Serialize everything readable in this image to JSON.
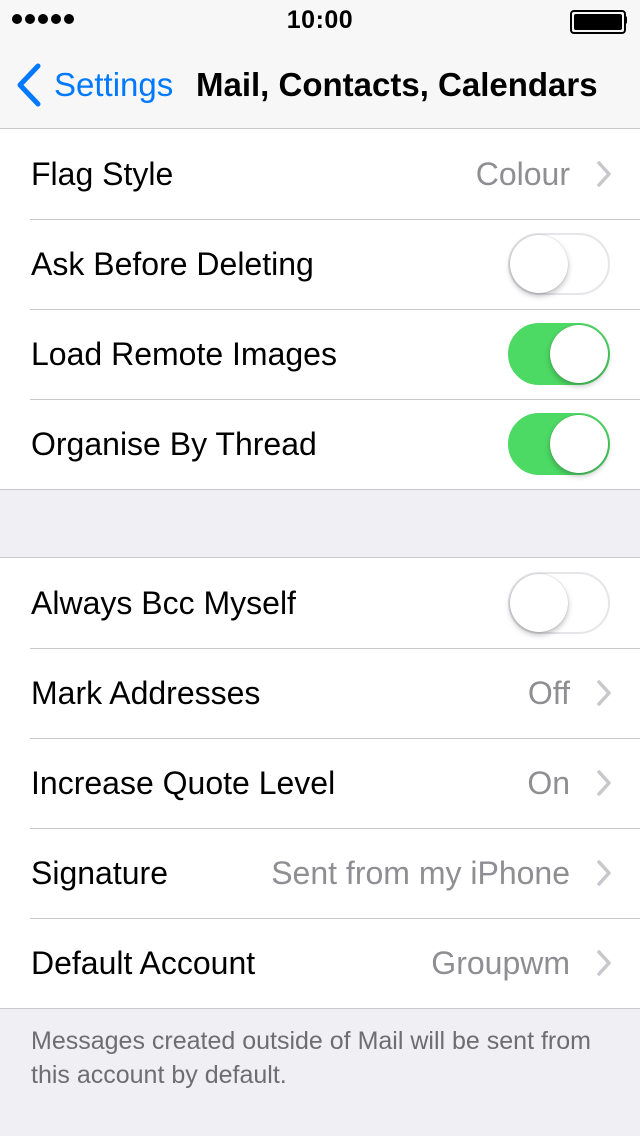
{
  "status_bar": {
    "time": "10:00",
    "signal_icon": "signal-dots-icon",
    "battery_icon": "battery-full-icon",
    "battery_level": 1.0
  },
  "nav": {
    "back_label": "Settings",
    "back_icon": "chevron-left-icon",
    "title": "Mail, Contacts, Calendars"
  },
  "colors": {
    "accent": "#0079ff",
    "toggle_on": "#4cd964",
    "background": "#efeff4",
    "secondary_text": "#8e8e93"
  },
  "group1": {
    "flag_style": {
      "label": "Flag Style",
      "value": "Colour"
    },
    "ask_before_deleting": {
      "label": "Ask Before Deleting",
      "state": "off"
    },
    "load_remote_images": {
      "label": "Load Remote Images",
      "state": "on"
    },
    "organise_by_thread": {
      "label": "Organise By Thread",
      "state": "on"
    }
  },
  "group2": {
    "always_bcc_myself": {
      "label": "Always Bcc Myself",
      "state": "off"
    },
    "mark_addresses": {
      "label": "Mark Addresses",
      "value": "Off"
    },
    "increase_quote_level": {
      "label": "Increase Quote Level",
      "value": "On"
    },
    "signature": {
      "label": "Signature",
      "value": "Sent from my iPhone"
    },
    "default_account": {
      "label": "Default Account",
      "value": "Groupwm"
    }
  },
  "footer_text": "Messages created outside of Mail will be sent from this account by default."
}
